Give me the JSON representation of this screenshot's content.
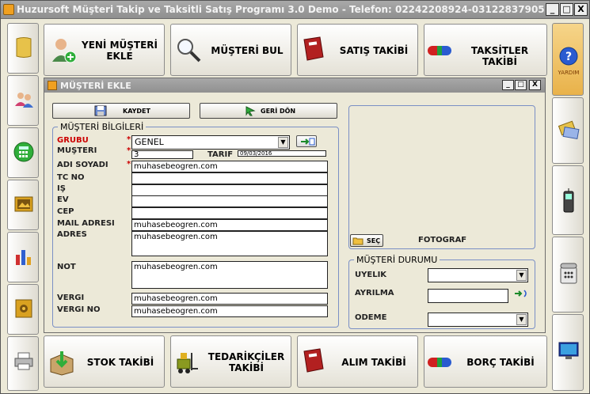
{
  "window": {
    "title": "Huzursoft Müşteri Takip ve Taksitli Satış Programı 3.0 Demo - Telefon: 02242208924-03122837905",
    "minimize": "_",
    "maximize": "□",
    "close": "X"
  },
  "top_buttons": [
    {
      "label": "YENİ MÜŞTERİ EKLE",
      "icon": "user-add-icon"
    },
    {
      "label": "MÜŞTERİ BUL",
      "icon": "magnifier-icon"
    },
    {
      "label": "SATIŞ TAKİBİ",
      "icon": "red-book-icon"
    },
    {
      "label": "TAKSİTLER TAKİBİ",
      "icon": "pill-capsule-icon"
    }
  ],
  "bottom_buttons": [
    {
      "label": "STOK TAKİBİ",
      "icon": "box-arrow-icon"
    },
    {
      "label": "TEDARİKÇİLER TAKİBİ",
      "icon": "forklift-icon"
    },
    {
      "label": "ALIM TAKİBİ",
      "icon": "red-book-icon"
    },
    {
      "label": "BORÇ TAKİBİ",
      "icon": "pill-capsule-icon"
    }
  ],
  "right_help": {
    "label": "YARDIM",
    "icon": "help-icon"
  },
  "dialog": {
    "title": "MÜŞTERİ EKLE",
    "save_label": "KAYDET",
    "back_label": "GERİ DÖN",
    "customer_info_legend": "MÜŞTERİ BİLGİLERİ",
    "fields": {
      "group_label": "GRUBU",
      "group_value": "GENEL",
      "customer_no_label": "MÜŞTERİ",
      "customer_no_value": "3",
      "date_label": "TARİF",
      "date_value": "09/03/2016",
      "name_label": "ADI SOYADI",
      "name_value": "muhasebeogren.com",
      "tc_label": "TC NO",
      "tc_value": "",
      "work_label": "İŞ",
      "work_value": "",
      "home_label": "EV",
      "home_value": "",
      "mobile_label": "CEP",
      "mobile_value": "",
      "mail_label": "MAİL ADRESİ",
      "mail_value": "muhasebeogren.com",
      "address_label": "ADRES",
      "address_value": "muhasebeogren.com",
      "note_label": "NOT",
      "note_value": "muhasebeogren.com",
      "tax_office_label": "VERGİ",
      "tax_office_value": "muhasebeogren.com",
      "tax_no_label": "VERGİ NO",
      "tax_no_value": "muhasebeogren.com"
    },
    "photo_select_label": "SEÇ",
    "photo_label": "FOTOĞRAF",
    "status_legend": "MÜŞTERİ DURUMU",
    "status": {
      "membership_label": "ÜYELİK",
      "membership_value": "",
      "separation_label": "AYRILMA",
      "separation_value": "",
      "payment_label": "ÖDEME",
      "payment_value": ""
    }
  }
}
